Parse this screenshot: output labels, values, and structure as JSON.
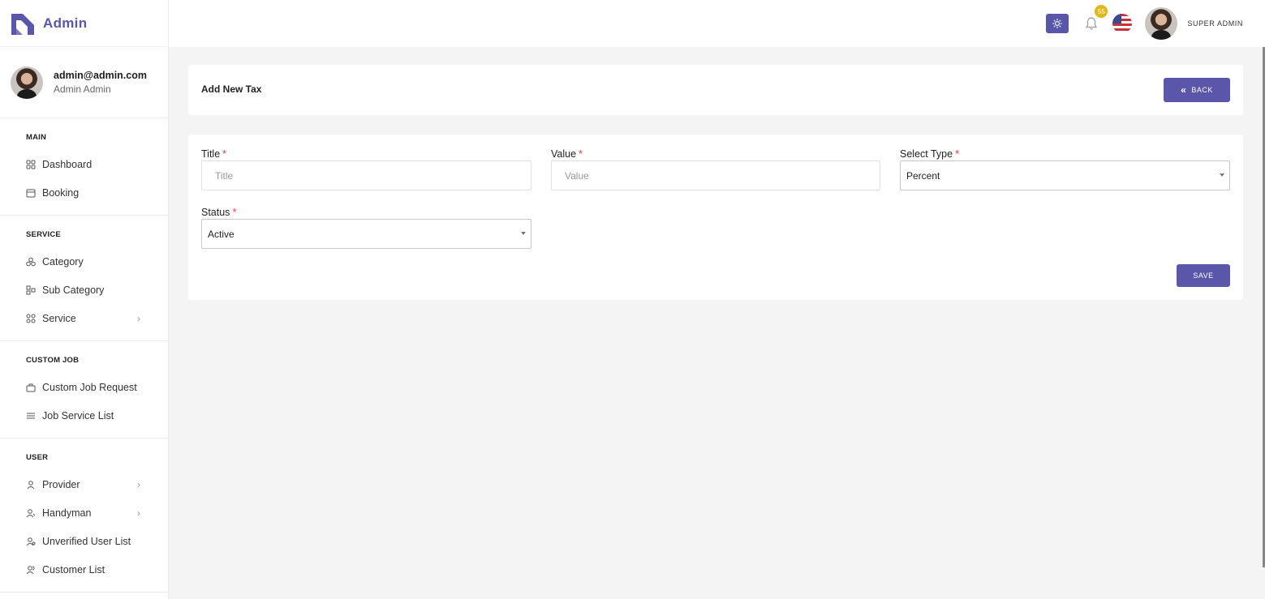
{
  "brand": {
    "name": "Admin"
  },
  "profile": {
    "email": "admin@admin.com",
    "name": "Admin Admin"
  },
  "sidebar": {
    "sections": [
      {
        "heading": "MAIN",
        "items": [
          {
            "label": "Dashboard",
            "icon": "dashboard-icon",
            "has_children": false
          },
          {
            "label": "Booking",
            "icon": "calendar-icon",
            "has_children": false
          }
        ]
      },
      {
        "heading": "SERVICE",
        "items": [
          {
            "label": "Category",
            "icon": "category-icon",
            "has_children": false
          },
          {
            "label": "Sub Category",
            "icon": "sub-category-icon",
            "has_children": false
          },
          {
            "label": "Service",
            "icon": "service-icon",
            "has_children": true
          }
        ]
      },
      {
        "heading": "CUSTOM JOB",
        "items": [
          {
            "label": "Custom Job Request",
            "icon": "briefcase-icon",
            "has_children": false
          },
          {
            "label": "Job Service List",
            "icon": "list-icon",
            "has_children": false
          }
        ]
      },
      {
        "heading": "USER",
        "items": [
          {
            "label": "Provider",
            "icon": "user-icon",
            "has_children": true
          },
          {
            "label": "Handyman",
            "icon": "user-tool-icon",
            "has_children": true
          },
          {
            "label": "Unverified User List",
            "icon": "user-unverified-icon",
            "has_children": false
          },
          {
            "label": "Customer List",
            "icon": "users-icon",
            "has_children": false
          }
        ]
      }
    ]
  },
  "topbar": {
    "notification_count": "55",
    "user_label": "SUPER ADMIN"
  },
  "header": {
    "title": "Add New Tax",
    "back_label": "BACK"
  },
  "form": {
    "title_label": "Title",
    "title_placeholder": "Title",
    "value_label": "Value",
    "value_placeholder": "Value",
    "type_label": "Select Type",
    "type_selected": "Percent",
    "status_label": "Status",
    "status_selected": "Active",
    "required_mark": "*",
    "save_label": "SAVE"
  },
  "colors": {
    "accent": "#5a57ab",
    "badge": "#e2b71a",
    "required": "#e0403d"
  }
}
